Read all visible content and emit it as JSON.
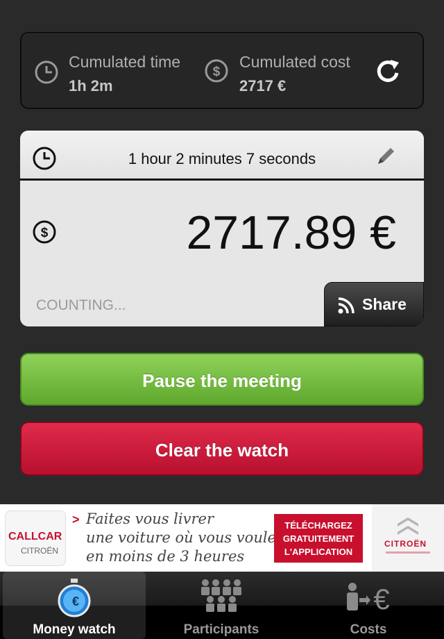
{
  "summary": {
    "time_label": "Cumulated time",
    "time_value": "1h 2m",
    "cost_label": "Cumulated cost",
    "cost_value": "2717 €"
  },
  "timer": {
    "duration": "1 hour 2 minutes 7 seconds",
    "amount": "2717.89 €",
    "status": "COUNTING...",
    "share_label": "Share"
  },
  "buttons": {
    "pause": "Pause the meeting",
    "clear": "Clear the watch"
  },
  "ad": {
    "logo_line1": "CALLCAR",
    "logo_line2": "CITROËN",
    "arrow": ">",
    "text_lines": [
      "Faites vous livrer",
      "une voiture où vous voulez",
      "en moins de 3 heures"
    ],
    "cta_lines": [
      "TÉLÉCHARGEZ",
      "GRATUITEMENT",
      "L'APPLICATION"
    ],
    "brand": "CITROËN"
  },
  "tabs": [
    {
      "label": "Money watch",
      "icon": "stopwatch-euro-icon",
      "active": true
    },
    {
      "label": "Participants",
      "icon": "people-group-icon",
      "active": false
    },
    {
      "label": "Costs",
      "icon": "person-euro-icon",
      "active": false
    }
  ],
  "colors": {
    "pause": "#6cb83a",
    "clear": "#c8102e",
    "background": "#2a2a2a"
  }
}
